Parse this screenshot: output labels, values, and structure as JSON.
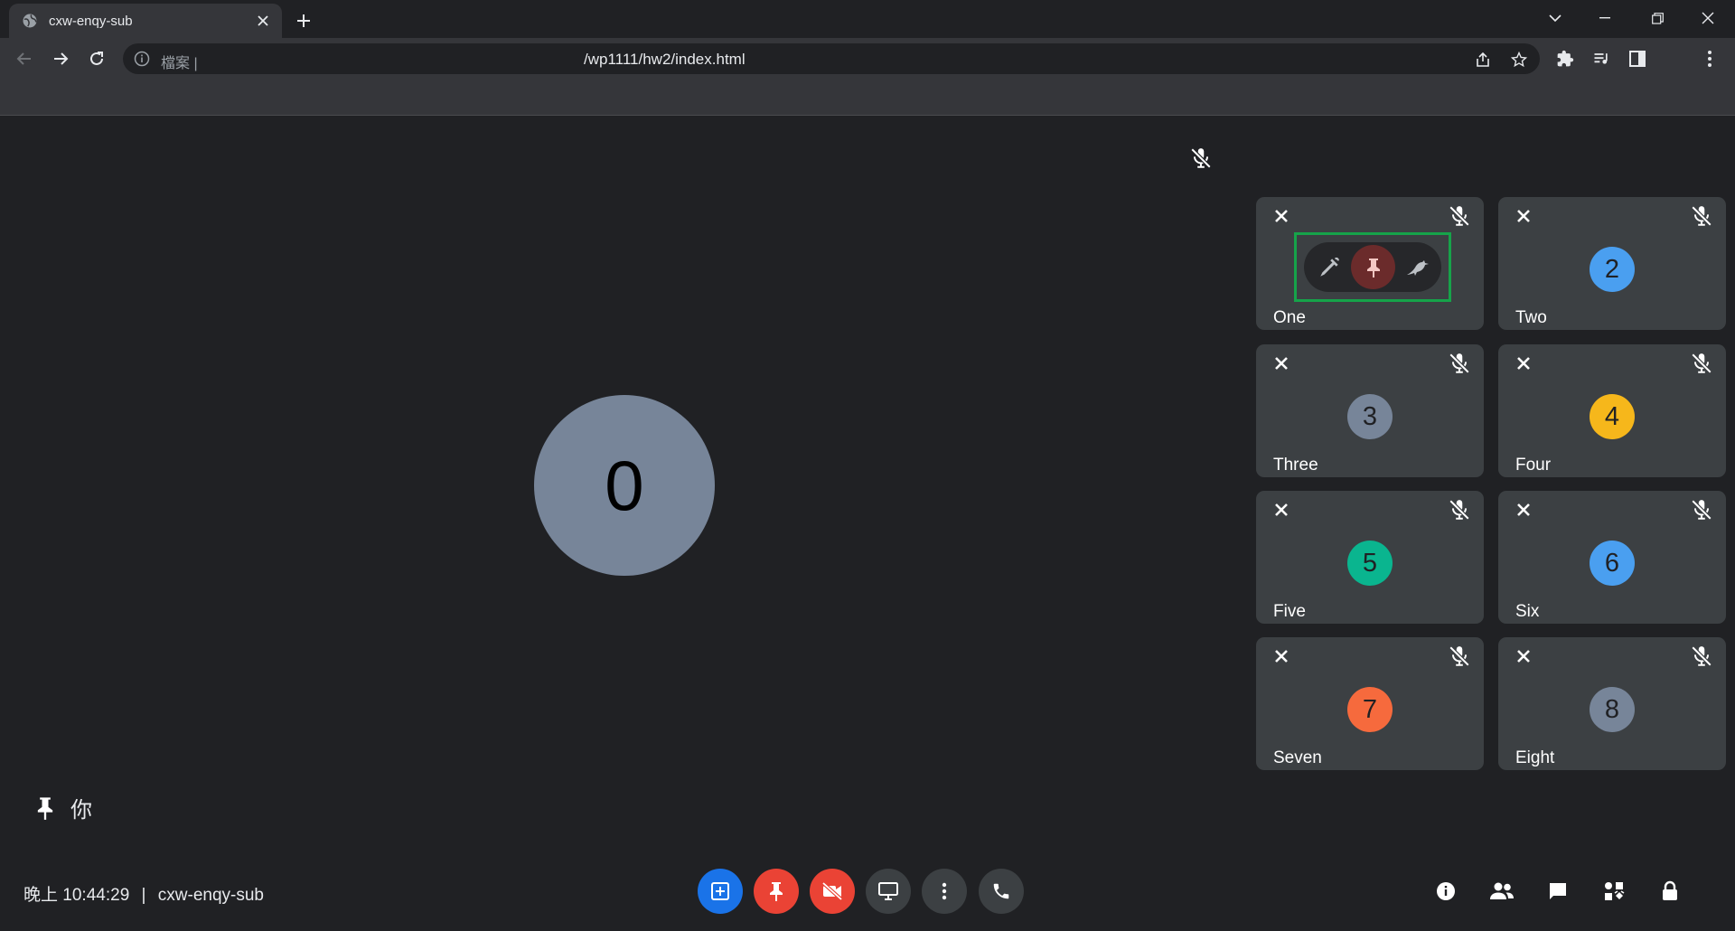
{
  "browser": {
    "tab_title": "cxw-enqy-sub",
    "scheme_label": "檔案 |",
    "url": "/wp1111/hw2/index.html"
  },
  "meeting": {
    "main_participant": {
      "initial": "0",
      "color": "#778599"
    },
    "self_label": "你",
    "hover_actions": [
      "pen-icon",
      "pin-icon",
      "bird-icon"
    ],
    "participants": [
      {
        "name": "One",
        "initial": "",
        "color": "",
        "hovered": true
      },
      {
        "name": "Two",
        "initial": "2",
        "color": "#4a9ff0"
      },
      {
        "name": "Three",
        "initial": "3",
        "color": "#778599"
      },
      {
        "name": "Four",
        "initial": "4",
        "color": "#f6b71b"
      },
      {
        "name": "Five",
        "initial": "5",
        "color": "#0ab58f"
      },
      {
        "name": "Six",
        "initial": "6",
        "color": "#4a9ff0"
      },
      {
        "name": "Seven",
        "initial": "7",
        "color": "#f66a3d"
      },
      {
        "name": "Eight",
        "initial": "8",
        "color": "#778599"
      }
    ]
  },
  "bottom_bar": {
    "period": "晚上",
    "time": "10:44:29",
    "separator": "|",
    "meeting_code": "cxw-enqy-sub",
    "controls": [
      {
        "icon": "add-box-icon",
        "color": "#1a73e8"
      },
      {
        "icon": "pin-icon",
        "color": "#ea4335"
      },
      {
        "icon": "video-off-icon",
        "color": "#ea4335"
      },
      {
        "icon": "present-screen-icon",
        "color": "#3c4043"
      },
      {
        "icon": "more-vert-icon",
        "color": "#3c4043"
      },
      {
        "icon": "phone-icon",
        "color": "#3c4043"
      }
    ],
    "right_icons": [
      "info-icon",
      "people-icon",
      "chat-icon",
      "activities-icon",
      "lock-icon"
    ]
  }
}
